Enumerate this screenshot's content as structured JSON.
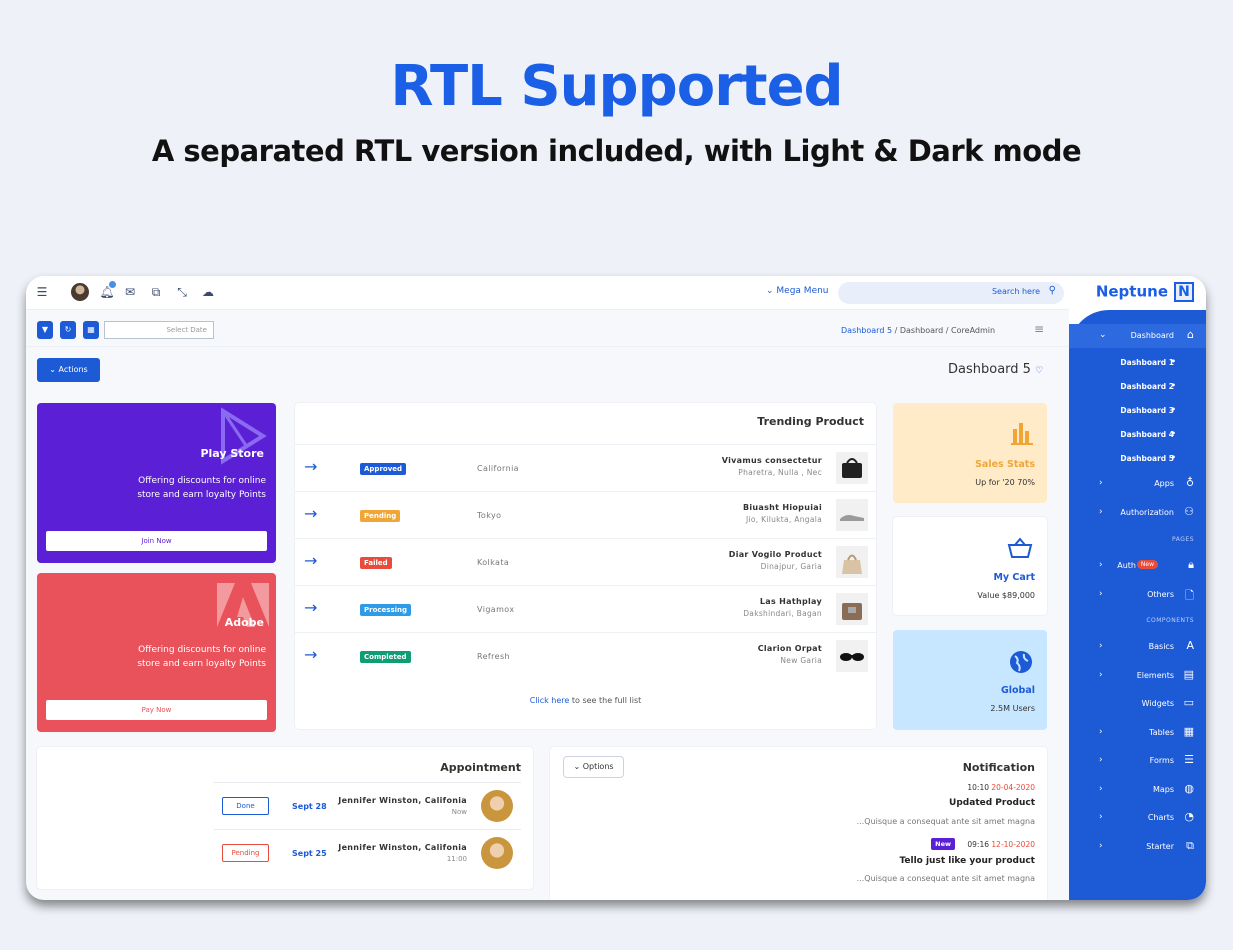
{
  "hero": {
    "title": "RTL Supported",
    "subtitle": "A separated RTL version included, with Light & Dark mode"
  },
  "topbar": {
    "mega_menu": "Mega Menu",
    "search_placeholder": "Search here"
  },
  "brand": {
    "name": "Neptune",
    "logo_letter": "N"
  },
  "toolbar": {
    "date_placeholder": "Select Date",
    "actions_label": "Actions"
  },
  "breadcrumb": {
    "current": "Dashboard 5",
    "mid": "Dashboard",
    "root": "CoreAdmin",
    "sep": "/"
  },
  "page_title": "Dashboard 5",
  "promos": [
    {
      "name": "Play Store",
      "desc": "Offering discounts for online store and earn loyalty Points",
      "button": "Join Now",
      "color": "#5b1fd6"
    },
    {
      "name": "Adobe",
      "desc": "Offering discounts for online store and earn loyalty Points",
      "button": "Pay Now",
      "color": "#e9525a"
    }
  ],
  "trending": {
    "title": "Trending Product",
    "rows": [
      {
        "status": "Approved",
        "status_color": "#1d5ad6",
        "location": "California",
        "product": "Vivamus consectetur",
        "place": "Pharetra, Nulla , Nec"
      },
      {
        "status": "Pending",
        "status_color": "#f0a637",
        "location": "Tokyo",
        "product": "Biuasht Hiopuiai",
        "place": "Jio, Kilukta, Angala"
      },
      {
        "status": "Failed",
        "status_color": "#e74c3c",
        "location": "Kolkata",
        "product": "Diar Vogilo Product",
        "place": "Dinajpur, Garia"
      },
      {
        "status": "Processing",
        "status_color": "#2e9be6",
        "location": "Vigamox",
        "product": "Las Hathplay",
        "place": "Dakshindari, Bagan"
      },
      {
        "status": "Completed",
        "status_color": "#0f9d74",
        "location": "Refresh",
        "product": "Clarion Orpat",
        "place": "New Garia"
      }
    ],
    "footer_link": "Click here",
    "footer_text": " to see the full list"
  },
  "stats": [
    {
      "title": "Sales Stats",
      "sub": "Up for '20 70%",
      "bg": "#ffebc7",
      "color": "#f0a637",
      "icon": "bar-chart-icon"
    },
    {
      "title": "My Cart",
      "sub": "Value $89,000",
      "bg": "#ffffff",
      "color": "#1d5ad6",
      "icon": "basket-icon"
    },
    {
      "title": "Global",
      "sub": "2.5M Users",
      "bg": "#c7e6ff",
      "color": "#1d5ad6",
      "icon": "globe-icon"
    }
  ],
  "appointment": {
    "title": "Appointment",
    "rows": [
      {
        "status": "Done",
        "status_color": "#1d5ad6",
        "date": "Sept 28",
        "who": "Jennifer Winston, Califonia",
        "when": "Now"
      },
      {
        "status": "Pending",
        "status_color": "#e74c3c",
        "date": "Sept 25",
        "who": "Jennifer Winston, Califonia",
        "when": "11:00"
      }
    ]
  },
  "notification": {
    "title": "Notification",
    "options": "Options",
    "items": [
      {
        "time": "10:10",
        "date": "20-04-2020",
        "head": "Updated Product",
        "text": "...Quisque a consequat ante sit amet magna",
        "tag": ""
      },
      {
        "time": "09:16",
        "date": "12-10-2020",
        "head": "Tello just like your product",
        "text": "...Quisque a consequat ante sit amet magna",
        "tag": "New"
      }
    ]
  },
  "sidebar": {
    "dashboard": "Dashboard",
    "sub": [
      "Dashboard 1",
      "Dashboard 2",
      "Dashboard 3",
      "Dashboard 4",
      "Dashboard 5"
    ],
    "apps": "Apps",
    "authorization": "Authorization",
    "pages_head": "PAGES",
    "auth": "Auth",
    "auth_badge": "New",
    "others": "Others",
    "components_head": "COMPONENTS",
    "basics": "Basics",
    "elements": "Elements",
    "widgets": "Widgets",
    "tables": "Tables",
    "forms": "Forms",
    "maps": "Maps",
    "charts": "Charts",
    "starter": "Starter"
  }
}
